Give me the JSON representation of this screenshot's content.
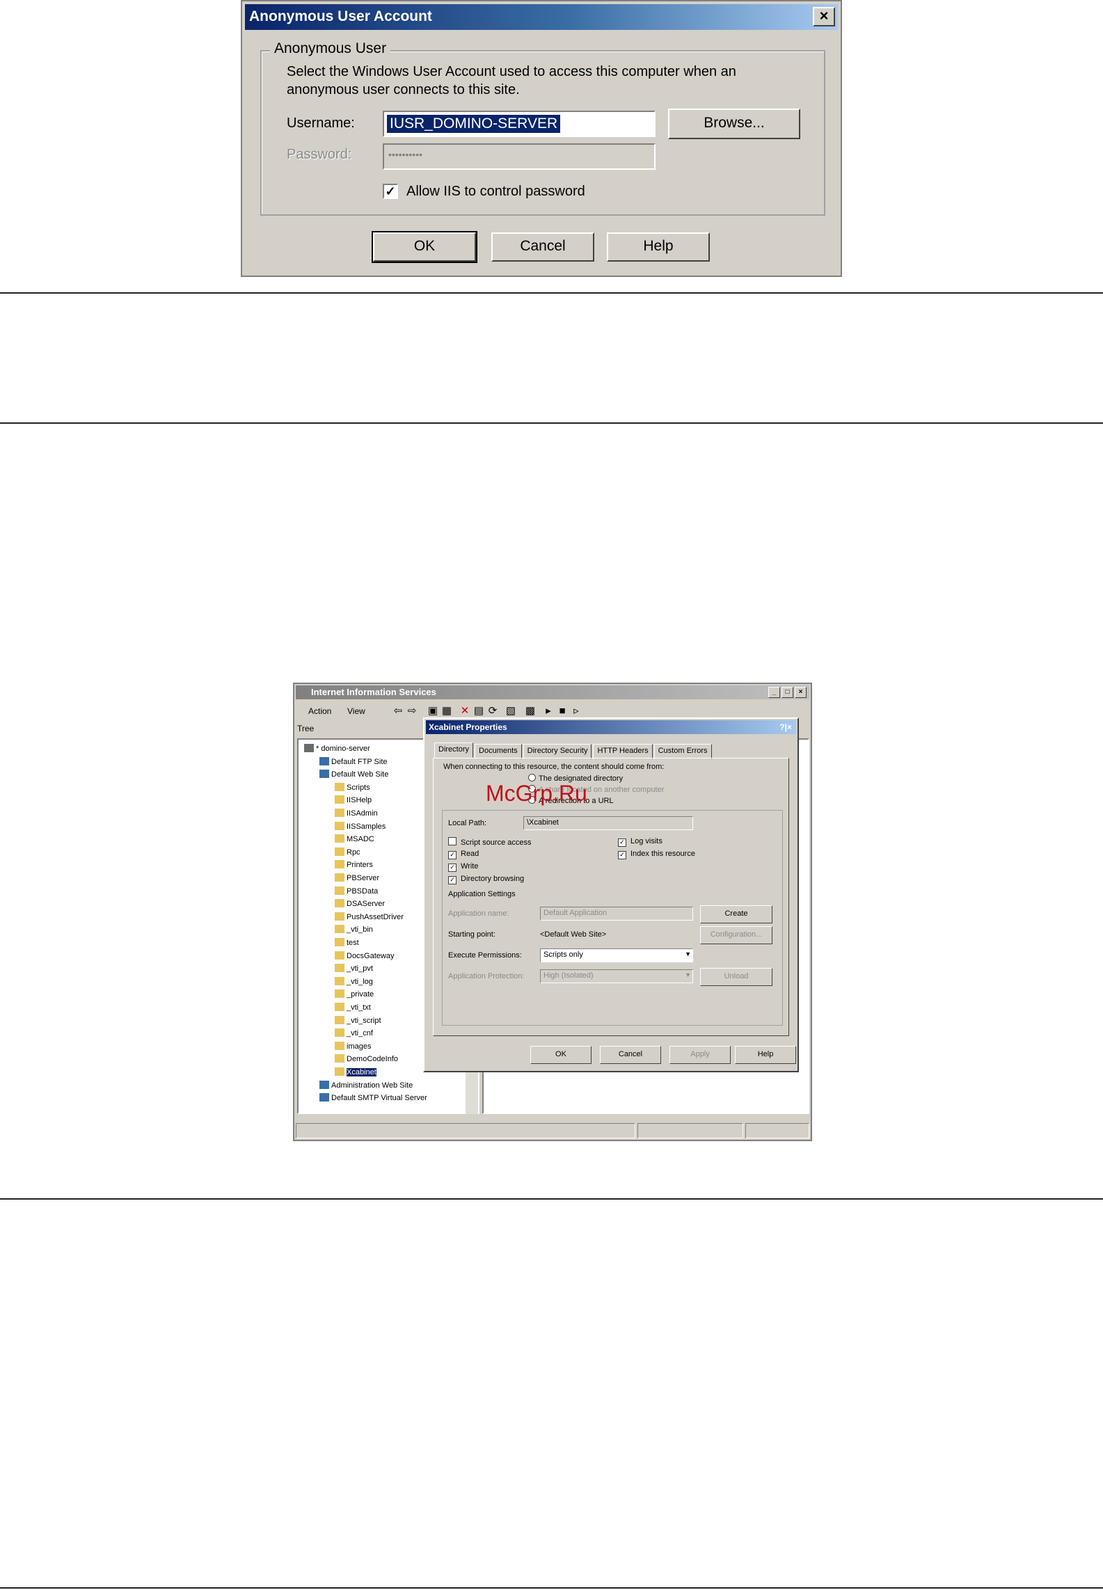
{
  "dialog1": {
    "title": "Anonymous User Account",
    "close_glyph": "×",
    "group_label": "Anonymous User",
    "description": "Select the Windows User Account used to access this computer when an anonymous user connects to this site.",
    "username_label": "Username:",
    "username_value": "IUSR_DOMINO-SERVER",
    "password_label": "Password:",
    "password_value": "••••••••••",
    "browse_label": "Browse...",
    "allow_iis_label": "Allow IIS to control password",
    "allow_iis_checked": true,
    "ok_label": "OK",
    "cancel_label": "Cancel",
    "help_label": "Help"
  },
  "iis": {
    "title": "Internet Information Services",
    "menu": [
      "Action",
      "View"
    ],
    "tree_tab": "Tree",
    "tree_items": [
      {
        "label": "* domino-server",
        "level": 0
      },
      {
        "label": "Default FTP Site",
        "level": 1
      },
      {
        "label": "Default Web Site",
        "level": 1
      },
      {
        "label": "Scripts",
        "level": 2
      },
      {
        "label": "IISHelp",
        "level": 2
      },
      {
        "label": "IISAdmin",
        "level": 2
      },
      {
        "label": "IISSamples",
        "level": 2
      },
      {
        "label": "MSADC",
        "level": 2
      },
      {
        "label": "Rpc",
        "level": 2
      },
      {
        "label": "Printers",
        "level": 2
      },
      {
        "label": "PBServer",
        "level": 2
      },
      {
        "label": "PBSData",
        "level": 2
      },
      {
        "label": "DSAServer",
        "level": 2
      },
      {
        "label": "PushAssetDriver",
        "level": 2
      },
      {
        "label": "_vti_bin",
        "level": 2
      },
      {
        "label": "test",
        "level": 2
      },
      {
        "label": "DocsGateway",
        "level": 2
      },
      {
        "label": "_vti_pvt",
        "level": 2
      },
      {
        "label": "_vti_log",
        "level": 2
      },
      {
        "label": "_private",
        "level": 2
      },
      {
        "label": "_vti_txt",
        "level": 2
      },
      {
        "label": "_vti_script",
        "level": 2
      },
      {
        "label": "_vti_cnf",
        "level": 2
      },
      {
        "label": "images",
        "level": 2
      },
      {
        "label": "DemoCodeInfo",
        "level": 2
      },
      {
        "label": "Xcabinet",
        "level": 2
      },
      {
        "label": "Administration Web Site",
        "level": 1
      },
      {
        "label": "Default SMTP Virtual Server",
        "level": 1
      }
    ]
  },
  "props": {
    "title": "Xcabinet Properties",
    "title_buttons": "?|×",
    "tabs": [
      "Directory",
      "Documents",
      "Directory Security",
      "HTTP Headers",
      "Custom Errors"
    ],
    "intro": "When connecting to this resource, the content should come from:",
    "radio1": "The designated directory",
    "radio2": "A share located on another computer",
    "radio3": "A redirection to a URL",
    "local_path_label": "Local Path:",
    "local_path_value": "\\Xcabinet",
    "script_source": "Script source access",
    "read": "Read",
    "write": "Write",
    "dir_browsing": "Directory browsing",
    "log_visits": "Log visits",
    "index_resource": "Index this resource",
    "app_settings": "Application Settings",
    "app_name_label": "Application name:",
    "app_name_value": "Default Application",
    "create_label": "Create",
    "starting_point_label": "Starting point:",
    "starting_point_value": "<Default Web Site>",
    "configuration_label": "Configuration...",
    "exec_perm_label": "Execute Permissions:",
    "exec_perm_value": "Scripts only",
    "app_protection_label": "Application Protection:",
    "app_protection_value": "High (Isolated)",
    "unload_label": "Unload",
    "ok": "OK",
    "cancel": "Cancel",
    "apply": "Apply",
    "help": "Help"
  },
  "watermark": "McGrp.Ru"
}
